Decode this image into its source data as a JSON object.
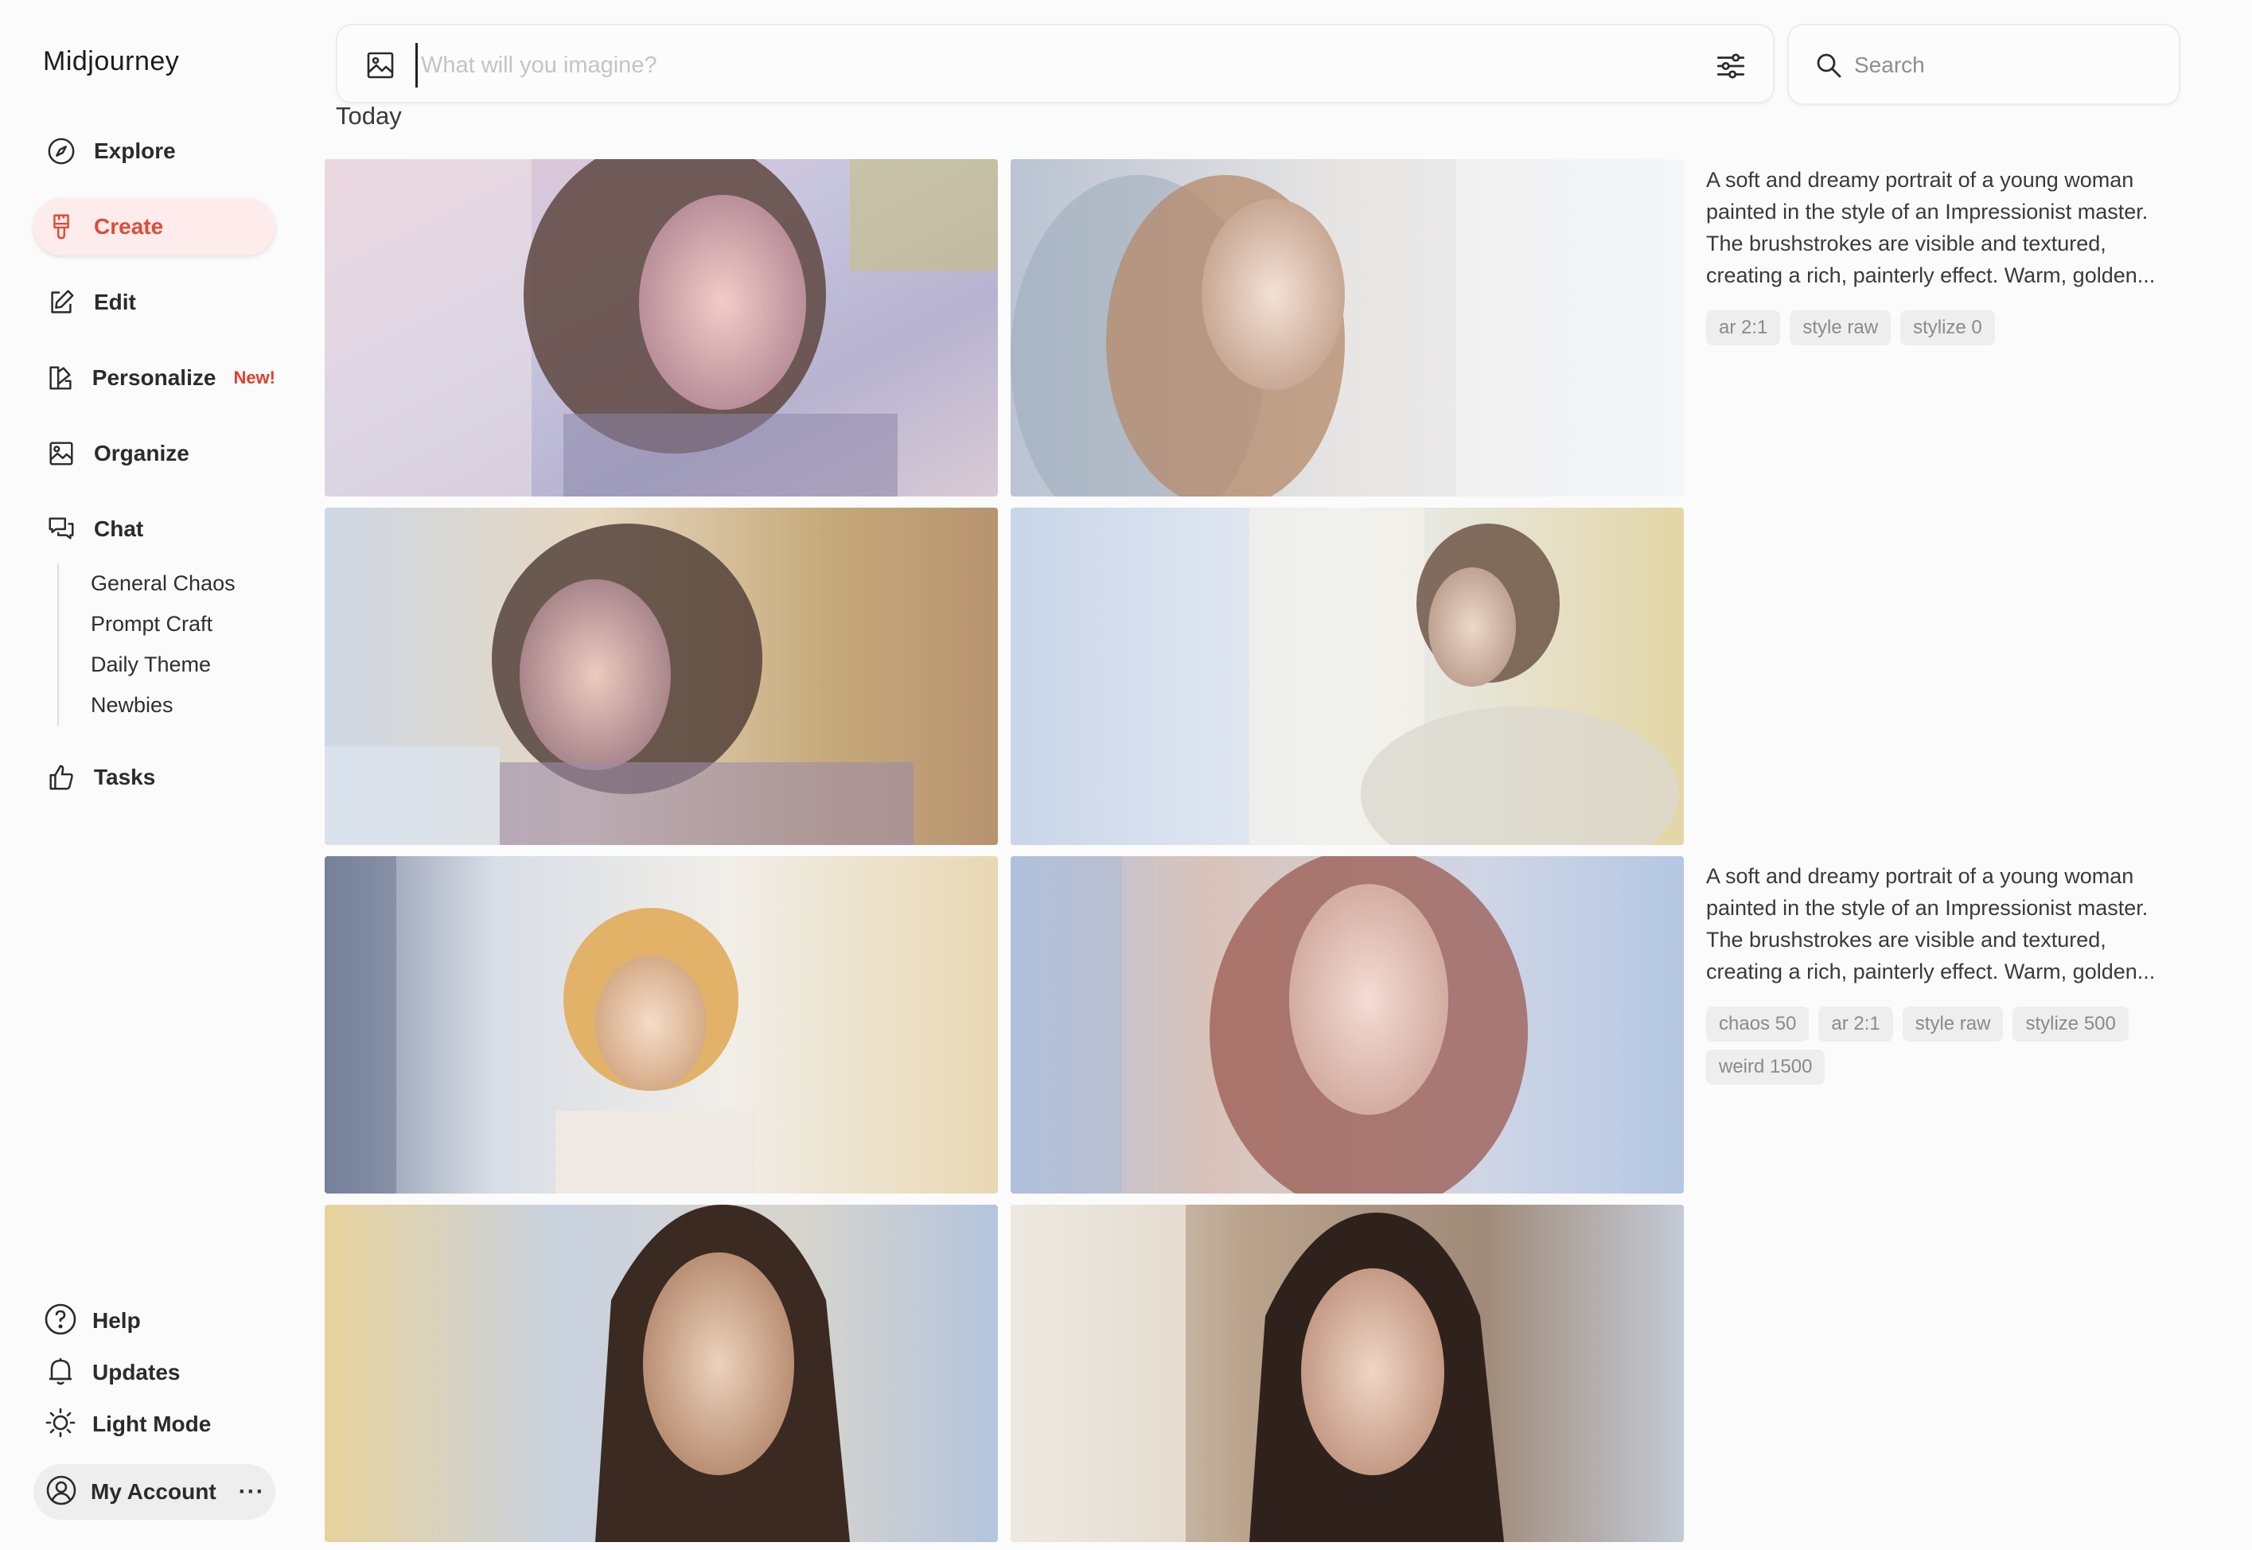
{
  "app": {
    "brand": "Midjourney"
  },
  "sidebar": {
    "nav": [
      {
        "label": "Explore",
        "icon": "compass-icon"
      },
      {
        "label": "Create",
        "icon": "brush-icon",
        "active": true
      },
      {
        "label": "Edit",
        "icon": "edit-icon"
      },
      {
        "label": "Personalize",
        "icon": "personalize-icon",
        "badge": "New!"
      },
      {
        "label": "Organize",
        "icon": "image-folder-icon"
      },
      {
        "label": "Chat",
        "icon": "chat-icon"
      }
    ],
    "chat_rooms": [
      "General Chaos",
      "Prompt Craft",
      "Daily Theme",
      "Newbies"
    ],
    "tasks": {
      "label": "Tasks",
      "icon": "thumbs-up-icon"
    },
    "bottom": [
      {
        "label": "Help",
        "icon": "help-icon"
      },
      {
        "label": "Updates",
        "icon": "bell-icon"
      },
      {
        "label": "Light Mode",
        "icon": "sun-icon"
      }
    ],
    "account": {
      "label": "My Account",
      "more": "···"
    }
  },
  "topbar": {
    "prompt_placeholder": "What will you imagine?",
    "search_placeholder": "Search"
  },
  "section_title": "Today",
  "jobs": [
    {
      "prompt": "A soft and dreamy portrait of a young woman painted in the style of an Impressionist master. The brushstrokes are visible and textured, creating a rich, painterly effect. Warm, golden...",
      "params": [
        "ar 2:1",
        "style raw",
        "stylize 0"
      ]
    },
    {
      "prompt": "A soft and dreamy portrait of a young woman painted in the style of an Impressionist master. The brushstrokes are visible and textured, creating a rich, painterly effect. Warm, golden...",
      "params": [
        "chaos 50",
        "ar 2:1",
        "style raw",
        "stylize 500",
        "weird 1500"
      ]
    }
  ],
  "colors": {
    "accent": "#e04b3a",
    "active_bg": "#fdeceb",
    "chip_bg": "#eeeeee",
    "badge": "#e0402d"
  }
}
